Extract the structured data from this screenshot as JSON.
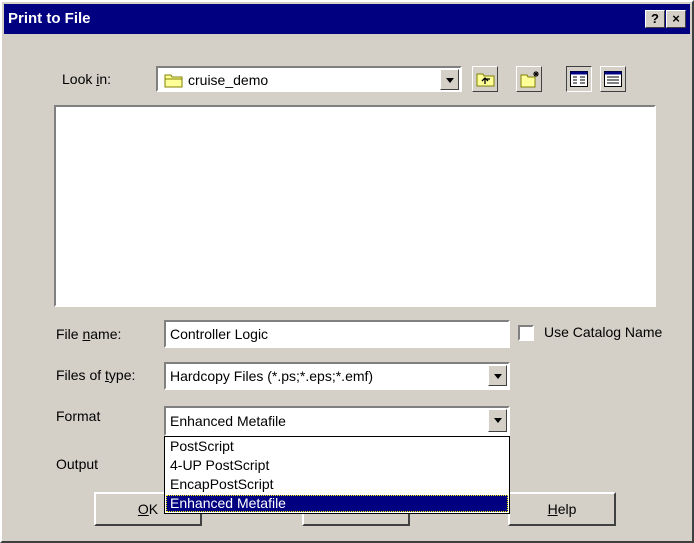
{
  "window": {
    "title": "Print to File",
    "help_btn": "?",
    "close_btn": "×"
  },
  "look_in": {
    "label_pre": "Look ",
    "label_key": "i",
    "label_post": "n:",
    "value": "cruise_demo"
  },
  "file_name": {
    "label_pre": "File ",
    "label_key": "n",
    "label_post": "ame:",
    "value": "Controller Logic"
  },
  "use_catalog": {
    "label": "Use Catalog Name",
    "checked": false
  },
  "files_of_type": {
    "label_pre": "Files of ",
    "label_key": "t",
    "label_post": "ype:",
    "value": "Hardcopy Files (*.ps;*.eps;*.emf)"
  },
  "format": {
    "label": "Format",
    "value": "Enhanced Metafile",
    "options": [
      "PostScript",
      "4-UP PostScript",
      "EncapPostScript",
      "Enhanced Metafile"
    ],
    "selected_index": 3
  },
  "output": {
    "label": "Output"
  },
  "buttons": {
    "ok_key": "O",
    "ok_rest": "K",
    "help_key": "H",
    "help_rest": "elp"
  }
}
